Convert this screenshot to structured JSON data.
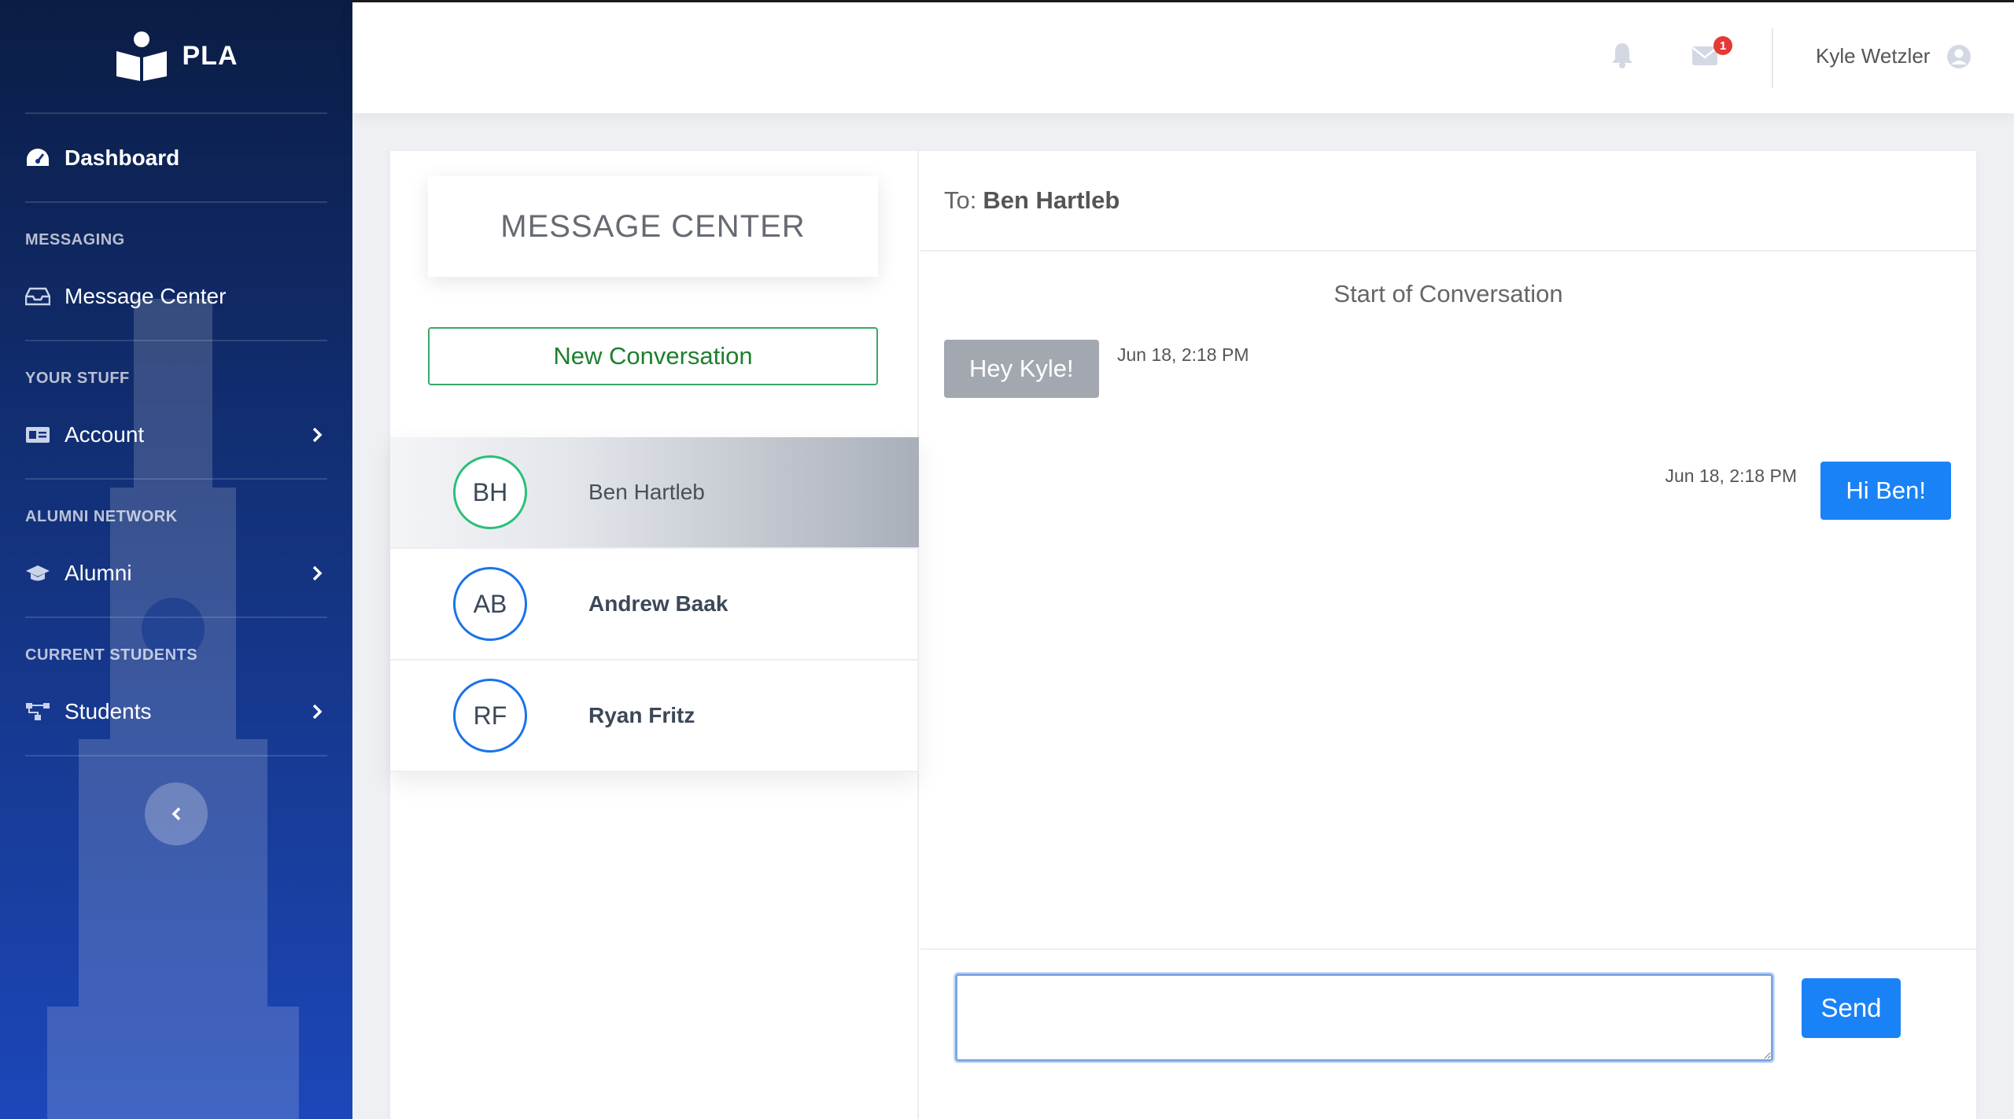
{
  "brand": {
    "name": "PLA"
  },
  "sidebar": {
    "dashboard_label": "Dashboard",
    "sections": {
      "messaging": "MESSAGING",
      "your_stuff": "YOUR STUFF",
      "alumni_network": "ALUMNI NETWORK",
      "current_students": "CURRENT STUDENTS"
    },
    "items": {
      "message_center": "Message Center",
      "account": "Account",
      "alumni": "Alumni",
      "students": "Students"
    }
  },
  "topbar": {
    "user_name": "Kyle Wetzler",
    "mail_badge": "1"
  },
  "left_panel": {
    "title": "MESSAGE CENTER",
    "new_conversation_label": "New Conversation",
    "conversations": [
      {
        "initials": "BH",
        "name": "Ben Hartleb"
      },
      {
        "initials": "AB",
        "name": "Andrew Baak"
      },
      {
        "initials": "RF",
        "name": "Ryan Fritz"
      }
    ]
  },
  "chat": {
    "to_prefix": "To:",
    "to_name": "Ben Hartleb",
    "start_label": "Start of Conversation",
    "messages": [
      {
        "text": "Hey Kyle!",
        "time": "Jun 18, 2:18 PM"
      },
      {
        "text": "Hi Ben!",
        "time": "Jun 18, 2:18 PM"
      }
    ],
    "input_value": "",
    "send_label": "Send"
  },
  "colors": {
    "sidebar_top": "#0b1d45",
    "sidebar_bottom": "#1c47b9",
    "accent_blue": "#1a82f7",
    "accent_green": "#3aa86a",
    "incoming_bubble": "#a3a8b0",
    "badge_red": "#e53935"
  }
}
